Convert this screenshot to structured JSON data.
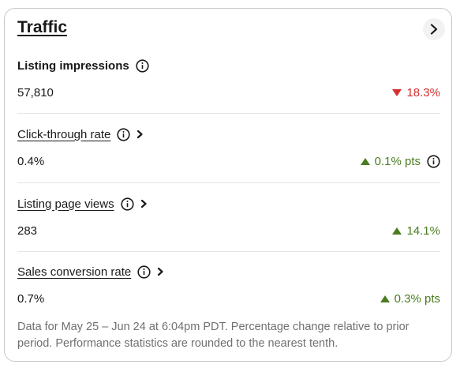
{
  "card": {
    "title": "Traffic"
  },
  "metrics": [
    {
      "label": "Listing impressions",
      "value": "57,810",
      "change": "18.3%",
      "direction": "down",
      "has_chevron": false,
      "change_info": false
    },
    {
      "label": "Click-through rate",
      "value": "0.4%",
      "change": "0.1% pts",
      "direction": "up",
      "has_chevron": true,
      "change_info": true
    },
    {
      "label": "Listing page views",
      "value": "283",
      "change": "14.1%",
      "direction": "up",
      "has_chevron": true,
      "change_info": false
    },
    {
      "label": "Sales conversion rate",
      "value": "0.7%",
      "change": "0.3% pts",
      "direction": "up",
      "has_chevron": true,
      "change_info": false
    }
  ],
  "footnote": "Data for May 25 – Jun 24 at 6:04pm PDT. Percentage change relative to prior period. Performance statistics are rounded to the nearest tenth.",
  "colors": {
    "down": "#d32f2f",
    "up": "#4a7c1f",
    "text": "#191919",
    "muted": "#707070"
  },
  "icons": {
    "info": "info-circle-icon",
    "chevron": "chevron-right-icon",
    "down": "triangle-down-icon",
    "up": "triangle-up-icon"
  }
}
